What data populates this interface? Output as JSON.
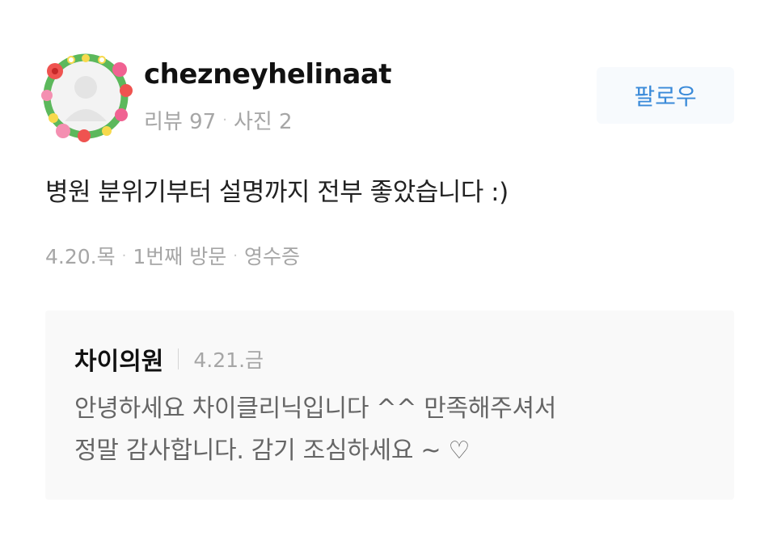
{
  "user": {
    "name": "chezneyhelinaat",
    "reviews": "리뷰 97",
    "photos": "사진 2",
    "avatar_icon": "default-profile-with-flower-wreath"
  },
  "follow_label": "팔로우",
  "review": {
    "text": "병원 분위기부터 설명까지 전부 좋았습니다 :)",
    "date": "4.20.목",
    "visit": "1번째 방문",
    "verification": "영수증"
  },
  "reply": {
    "author": "차이의원",
    "date": "4.21.금",
    "line1": "안녕하세요 차이클리닉입니다 ^^ 만족해주셔서",
    "line2": "정말 감사합니다. 감기 조심하세요 ~ ♡"
  },
  "colors": {
    "accent": "#3a8ad9",
    "muted": "#a6a6a6",
    "reply_bg": "#f9f9f9"
  }
}
